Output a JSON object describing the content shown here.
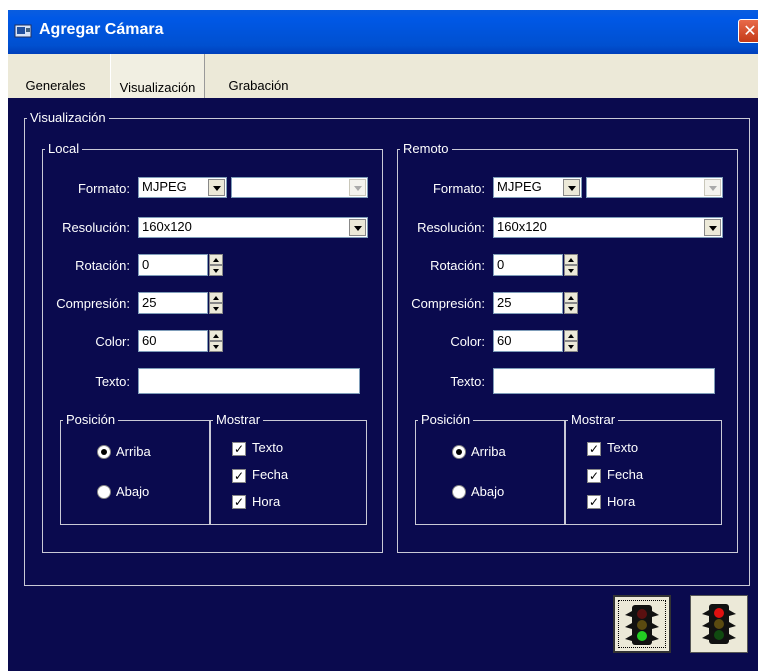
{
  "window": {
    "title": "Agregar Cámara",
    "close_glyph": "✕"
  },
  "tabs": [
    {
      "label": "Generales",
      "selected": false
    },
    {
      "label": "Visualización",
      "selected": true
    },
    {
      "label": "Grabación",
      "selected": false
    }
  ],
  "group_title": "Visualización",
  "local": {
    "title": "Local",
    "formato_label": "Formato:",
    "formato_value": "MJPEG",
    "formato_extra_value": "",
    "resolucion_label": "Resolución:",
    "resolucion_value": "160x120",
    "rotacion_label": "Rotación:",
    "rotacion_value": "0",
    "compresion_label": "Compresión:",
    "compresion_value": "25",
    "color_label": "Color:",
    "color_value": "60",
    "texto_label": "Texto:",
    "texto_value": "",
    "posicion_title": "Posición",
    "arriba_label": "Arriba",
    "abajo_label": "Abajo",
    "posicion_selected": "Arriba",
    "mostrar_title": "Mostrar",
    "mostrar_texto": "Texto",
    "mostrar_fecha": "Fecha",
    "mostrar_hora": "Hora",
    "check_mark": "✓"
  },
  "remoto": {
    "title": "Remoto",
    "formato_label": "Formato:",
    "formato_value": "MJPEG",
    "formato_extra_value": "",
    "resolucion_label": "Resolución:",
    "resolucion_value": "160x120",
    "rotacion_label": "Rotación:",
    "rotacion_value": "0",
    "compresion_label": "Compresión:",
    "compresion_value": "25",
    "color_label": "Color:",
    "color_value": "60",
    "texto_label": "Texto:",
    "texto_value": "",
    "posicion_title": "Posición",
    "arriba_label": "Arriba",
    "abajo_label": "Abajo",
    "posicion_selected": "Arriba",
    "mostrar_title": "Mostrar",
    "mostrar_texto": "Texto",
    "mostrar_fecha": "Fecha",
    "mostrar_hora": "Hora",
    "check_mark": "✓"
  },
  "buttons": [
    {
      "name": "accept-traffic-light-button",
      "icon": "traffic-light-green-icon"
    },
    {
      "name": "cancel-traffic-light-button",
      "icon": "traffic-light-red-icon"
    }
  ],
  "colors": {
    "background": "#0a0a4e",
    "titlebar": "#0058e6",
    "accent_green": "#22cc22",
    "accent_red": "#e01010"
  }
}
